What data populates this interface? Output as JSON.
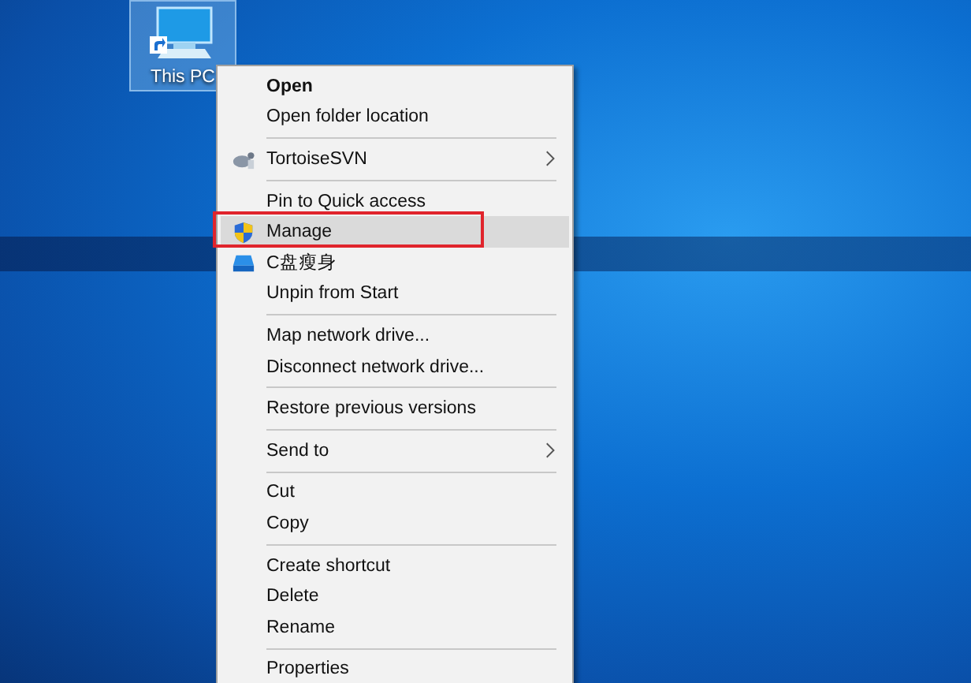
{
  "desktop_icon": {
    "label": "This PC",
    "selected": true
  },
  "context_menu": {
    "groups": [
      {
        "items": [
          {
            "kind": "plain",
            "label": "Open",
            "default": true,
            "selected": false
          },
          {
            "kind": "plain",
            "label": "Open folder location",
            "selected": false
          }
        ]
      },
      {
        "items": [
          {
            "kind": "tortoise",
            "label": "TortoiseSVN",
            "submenu": true,
            "selected": false
          }
        ]
      },
      {
        "items": [
          {
            "kind": "plain",
            "label": "Pin to Quick access",
            "selected": false
          },
          {
            "kind": "shield",
            "label": "Manage",
            "selected": true,
            "callout": true
          },
          {
            "kind": "drive",
            "label": "C盘瘦身",
            "selected": false
          },
          {
            "kind": "plain",
            "label": "Unpin from Start",
            "selected": false
          }
        ]
      },
      {
        "items": [
          {
            "kind": "plain",
            "label": "Map network drive...",
            "selected": false
          },
          {
            "kind": "plain",
            "label": "Disconnect network drive...",
            "selected": false
          }
        ]
      },
      {
        "items": [
          {
            "kind": "plain",
            "label": "Restore previous versions",
            "selected": false
          }
        ]
      },
      {
        "items": [
          {
            "kind": "plain",
            "label": "Send to",
            "submenu": true,
            "selected": false
          }
        ]
      },
      {
        "items": [
          {
            "kind": "plain",
            "label": "Cut",
            "selected": false
          },
          {
            "kind": "plain",
            "label": "Copy",
            "selected": false
          }
        ]
      },
      {
        "items": [
          {
            "kind": "plain",
            "label": "Create shortcut",
            "selected": false
          },
          {
            "kind": "plain",
            "label": "Delete",
            "selected": false
          },
          {
            "kind": "plain",
            "label": "Rename",
            "selected": false
          }
        ]
      },
      {
        "items": [
          {
            "kind": "plain",
            "label": "Properties",
            "selected": false
          }
        ]
      }
    ]
  }
}
